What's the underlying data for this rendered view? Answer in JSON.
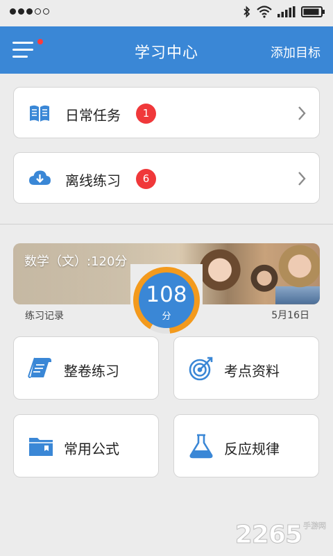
{
  "app": {
    "title": "学习中心",
    "add_goal_label": "添加目标"
  },
  "colors": {
    "primary": "#3a87d6",
    "badge": "#f0383a",
    "progress_ring": "#f39a1d"
  },
  "tasks": [
    {
      "label": "日常任务",
      "count": "1",
      "icon": "open-book-icon"
    },
    {
      "label": "离线练习",
      "count": "6",
      "icon": "cloud-download-icon"
    }
  ],
  "score": {
    "subject_label": "数学（文）:120分",
    "value": "108",
    "unit": "分",
    "fraction_of_total": 0.9,
    "record_label": "练习记录",
    "date": "5月16日"
  },
  "tiles": [
    {
      "label": "整卷练习",
      "icon": "exam-paper-icon"
    },
    {
      "label": "考点资料",
      "icon": "target-icon"
    },
    {
      "label": "常用公式",
      "icon": "folder-icon"
    },
    {
      "label": "反应规律",
      "icon": "flask-icon"
    }
  ],
  "watermark": {
    "number": "2265",
    "sub": "手游网"
  }
}
